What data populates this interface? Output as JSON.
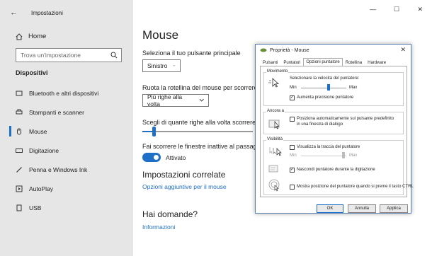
{
  "window": {
    "title": "Impostazioni",
    "back_glyph": "←",
    "controls": [
      "—",
      "☐",
      "✕"
    ]
  },
  "sidebar": {
    "home_label": "Home",
    "search_placeholder": "Trova un'impostazione",
    "section_title": "Dispositivi",
    "items": [
      {
        "label": "Bluetooth e altri dispositivi",
        "icon": "bluetooth-device-icon"
      },
      {
        "label": "Stampanti e scanner",
        "icon": "printer-icon"
      },
      {
        "label": "Mouse",
        "icon": "mouse-icon",
        "active": true
      },
      {
        "label": "Digitazione",
        "icon": "keyboard-icon"
      },
      {
        "label": "Penna e Windows Ink",
        "icon": "pen-icon"
      },
      {
        "label": "AutoPlay",
        "icon": "autoplay-icon"
      },
      {
        "label": "USB",
        "icon": "usb-icon"
      }
    ]
  },
  "main": {
    "title": "Mouse",
    "primary_button_label": "Seleziona il tuo pulsante principale",
    "primary_button_value": "Sinistro",
    "wheel_label": "Ruota la rotellina del mouse per scorrere",
    "wheel_value": "Più righe alla volta",
    "lines_label": "Scegli di quante righe alla volta scorrere",
    "lines_slider_fraction": 0.11,
    "inactive_label": "Fai scorrere le finestre inattive al passaggio",
    "inactive_toggle_state": "Attivato",
    "related_title": "Impostazioni correlate",
    "related_link": "Opzioni aggiuntive per il mouse",
    "questions_title": "Hai domande?",
    "questions_link": "Informazioni"
  },
  "dialog": {
    "title": "Proprietà - Mouse",
    "close_glyph": "✕",
    "tabs": [
      "Pulsanti",
      "Puntatori",
      "Opzioni puntatore",
      "Rotellina",
      "Hardware"
    ],
    "active_tab": 2,
    "movement": {
      "title": "Movimento",
      "speed_label": "Selezionare la velocità del puntatore:",
      "min": "Min",
      "max": "Max",
      "speed_fraction": 0.6,
      "precision_label": "Aumenta precisione puntatore",
      "precision_checked": true
    },
    "snap": {
      "title": "Ancora a",
      "label_line1": "Posiziona automaticamente sul pulsante predefinito",
      "label_line2": "in una finestra di dialogo",
      "checked": false
    },
    "visibility": {
      "title": "Visibilità",
      "trails_label": "Visualizza la traccia del puntatore",
      "trails_checked": false,
      "trails_min": "Min",
      "trails_max": "Max",
      "hide_label": "Nascondi puntatore durante la digitazione",
      "hide_checked": true,
      "ctrl_label": "Mostra posizione del puntatore quando si preme il tasto CTRL",
      "ctrl_checked": false
    },
    "buttons": {
      "ok": "OK",
      "cancel": "Annulla",
      "apply": "Applica"
    }
  }
}
